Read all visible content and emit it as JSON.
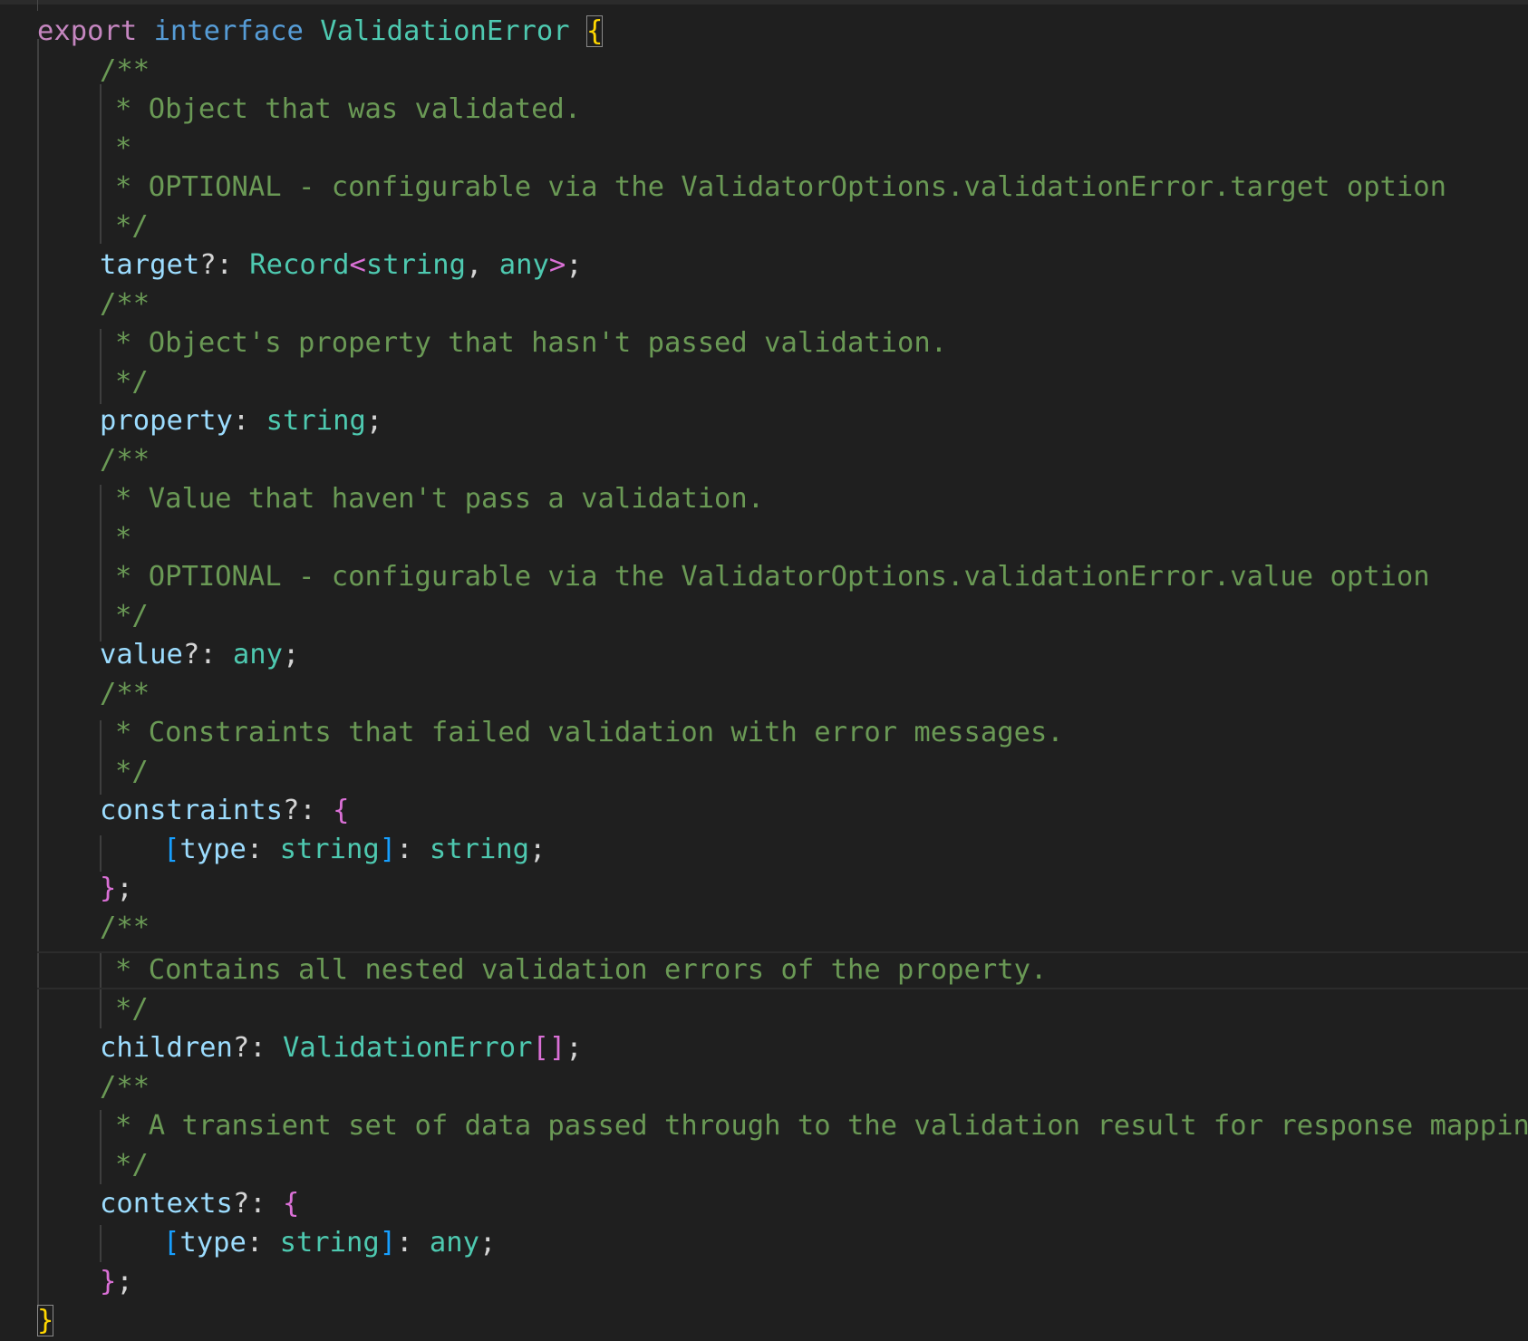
{
  "editor": {
    "colors": {
      "background": "#1f1f1f",
      "keyword": "#c586c0",
      "storage": "#569cd6",
      "type": "#4ec9b0",
      "property": "#9cdcfe",
      "comment": "#6a9955",
      "bracket_level1": "#ffd700",
      "bracket_level2": "#da70d6",
      "bracket_level3": "#179fff"
    },
    "header": {
      "export_kw": "export",
      "interface_kw": "interface",
      "name": "ValidationError",
      "open_brace": "{"
    },
    "target": {
      "doc_open": "/**",
      "doc_lines": [
        "* Object that was validated.",
        "*",
        "* OPTIONAL - configurable via the ValidatorOptions.validationError.target option",
        "*/"
      ],
      "name": "target",
      "opt": "?: ",
      "type_name": "Record",
      "lt": "<",
      "type_arg1": "string",
      "comma": ", ",
      "type_arg2": "any",
      "gt": ">",
      "semi": ";"
    },
    "property": {
      "doc_open": "/**",
      "doc_lines": [
        "* Object's property that hasn't passed validation.",
        "*/"
      ],
      "name": "property",
      "colon": ": ",
      "type_name": "string",
      "semi": ";"
    },
    "value": {
      "doc_open": "/**",
      "doc_lines": [
        "* Value that haven't pass a validation.",
        "*",
        "* OPTIONAL - configurable via the ValidatorOptions.validationError.value option",
        "*/"
      ],
      "name": "value",
      "opt": "?: ",
      "type_name": "any",
      "semi": ";"
    },
    "constraints": {
      "doc_open": "/**",
      "doc_lines": [
        "* Constraints that failed validation with error messages.",
        "*/"
      ],
      "name": "constraints",
      "opt": "?: ",
      "open_brace": "{",
      "index_open": "[",
      "index_key": "type",
      "index_colon": ": ",
      "index_type": "string",
      "index_close": "]",
      "colon": ": ",
      "value_type": "string",
      "semi": ";",
      "close_brace": "}"
    },
    "children": {
      "doc_open": "/**",
      "doc_lines": [
        "* Contains all nested validation errors of the property.",
        "*/"
      ],
      "name": "children",
      "opt": "?: ",
      "type_name": "ValidationError",
      "array": "[]",
      "semi": ";"
    },
    "contexts": {
      "doc_open": "/**",
      "doc_lines": [
        "* A transient set of data passed through to the validation result for response mapping",
        "*/"
      ],
      "name": "contexts",
      "opt": "?: ",
      "open_brace": "{",
      "index_open": "[",
      "index_key": "type",
      "index_colon": ": ",
      "index_type": "string",
      "index_close": "]",
      "colon": ": ",
      "value_type": "any",
      "semi": ";",
      "close_brace": "}"
    },
    "footer": {
      "close_brace": "}"
    }
  }
}
